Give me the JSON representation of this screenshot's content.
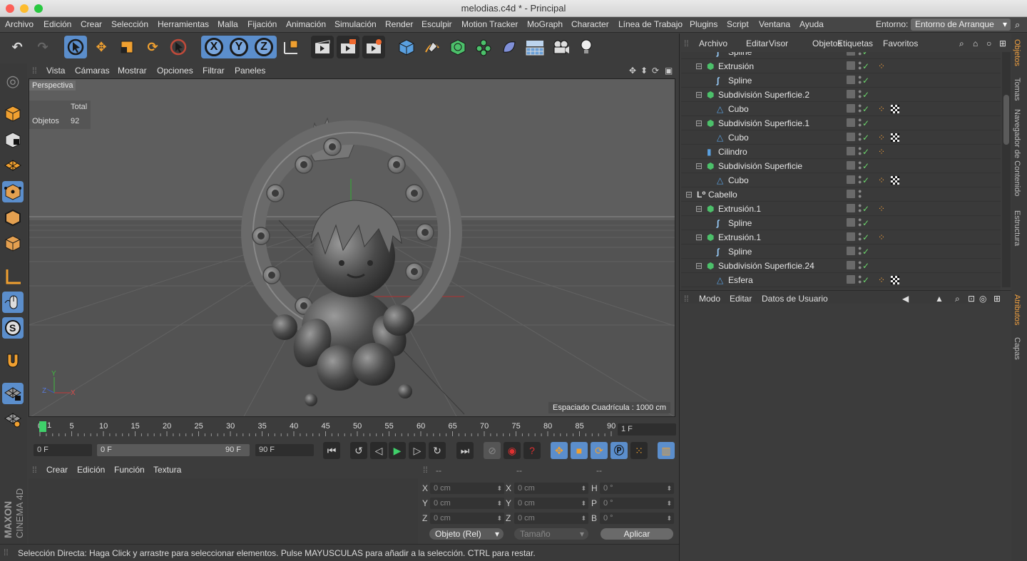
{
  "window": {
    "title": "melodias.c4d * - Principal"
  },
  "menu": {
    "items": [
      "Archivo",
      "Edición",
      "Crear",
      "Selección",
      "Herramientas",
      "Malla",
      "Fijación",
      "Animación",
      "Simulación",
      "Render",
      "Esculpir",
      "Motion Tracker",
      "MoGraph",
      "Character",
      "Línea de Trabajo",
      "Plugins",
      "Script",
      "Ventana",
      "Ayuda"
    ],
    "env_label": "Entorno:",
    "env_value": "Entorno de Arranque"
  },
  "toolbar": {
    "x_label": "X",
    "y_label": "Y",
    "z_label": "Z"
  },
  "viewport": {
    "menu": [
      "Vista",
      "Cámaras",
      "Mostrar",
      "Opciones",
      "Filtrar",
      "Paneles"
    ],
    "label": "Perspectiva",
    "stats_header": "Total",
    "stats_label": "Objetos",
    "stats_value": "92",
    "grid_text": "Espaciado Cuadrícula : 1000 cm",
    "axis_y": "Y",
    "axis_z": "Z",
    "axis_x": "X"
  },
  "timeline": {
    "ticks": [
      "0",
      "5",
      "10",
      "15",
      "20",
      "25",
      "30",
      "35",
      "40",
      "45",
      "50",
      "55",
      "60",
      "65",
      "70",
      "75",
      "80",
      "85",
      "90"
    ],
    "current_frame_marker": "1",
    "frame_field": "1 F"
  },
  "playbar": {
    "start": "0 F",
    "range_start": "0 F",
    "range_end": "90 F",
    "end": "90 F"
  },
  "material": {
    "menu": [
      "Crear",
      "Edición",
      "Función",
      "Textura"
    ]
  },
  "coords": {
    "headers": [
      "--",
      "--",
      "--"
    ],
    "pos": [
      {
        "l": "X",
        "v": "0 cm"
      },
      {
        "l": "Y",
        "v": "0 cm"
      },
      {
        "l": "Z",
        "v": "0 cm"
      }
    ],
    "size": [
      {
        "l": "X",
        "v": "0 cm"
      },
      {
        "l": "Y",
        "v": "0 cm"
      },
      {
        "l": "Z",
        "v": "0 cm"
      }
    ],
    "rot": [
      {
        "l": "H",
        "v": "0 °"
      },
      {
        "l": "P",
        "v": "0 °"
      },
      {
        "l": "B",
        "v": "0 °"
      }
    ],
    "mode": "Objeto (Rel)",
    "size_mode": "Tamaño",
    "apply": "Aplicar"
  },
  "status": "Selección Directa: Haga Click y arrastre para seleccionar elementos. Pulse MAYUSCULAS para añadir a la selección. CTRL para restar.",
  "objects": {
    "menu": [
      "Archivo",
      "Editar",
      "Visor",
      "Objetos",
      "Etiquetas",
      "Favoritos"
    ],
    "rows": [
      {
        "name": "Spline"
      },
      {
        "name": "Extrusión"
      },
      {
        "name": "Spline"
      },
      {
        "name": "Subdivisión Superficie.2"
      },
      {
        "name": "Cubo"
      },
      {
        "name": "Subdivisión Superficie.1"
      },
      {
        "name": "Cubo"
      },
      {
        "name": "Cilindro"
      },
      {
        "name": "Subdivisión Superficie"
      },
      {
        "name": "Cubo"
      },
      {
        "name": "Cabello"
      },
      {
        "name": "Extrusión.1"
      },
      {
        "name": "Spline"
      },
      {
        "name": "Extrusión.1"
      },
      {
        "name": "Spline"
      },
      {
        "name": "Subdivisión Superficie.24"
      },
      {
        "name": "Esfera"
      }
    ]
  },
  "attributes": {
    "menu": [
      "Modo",
      "Editar",
      "Datos de Usuario"
    ]
  },
  "sidetabs": [
    "Objetos",
    "Tomas",
    "Navegador de Contenido",
    "Estructura",
    "Atributos",
    "Capas"
  ],
  "logo": {
    "brand": "MAXON",
    "product": "CINEMA 4D"
  }
}
